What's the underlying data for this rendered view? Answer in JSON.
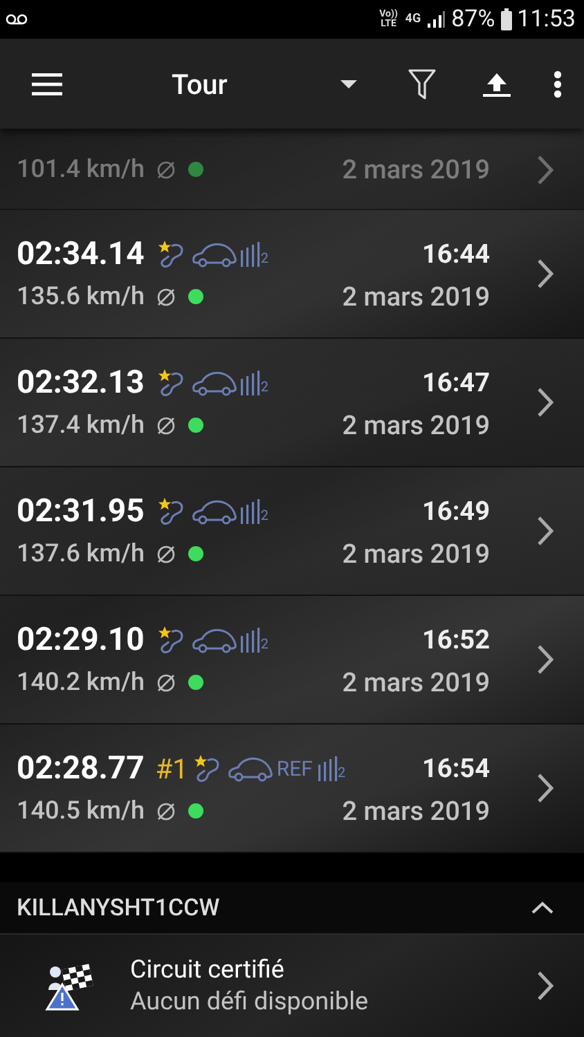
{
  "status_bar": {
    "volte": "Vo))",
    "lte": "LTE",
    "battery": "87%",
    "time": "11:53",
    "network": "4G"
  },
  "toolbar": {
    "title": "Tour"
  },
  "laps": [
    {
      "kind": "partial",
      "speed": "101.4 km/h",
      "date": "2 mars 2019"
    },
    {
      "kind": "full",
      "time": "02:34.14",
      "clock": "16:44",
      "speed": "135.6 km/h",
      "date": "2 mars 2019",
      "sensors": "2"
    },
    {
      "kind": "full",
      "time": "02:32.13",
      "clock": "16:47",
      "speed": "137.4 km/h",
      "date": "2 mars 2019",
      "sensors": "2"
    },
    {
      "kind": "full",
      "time": "02:31.95",
      "clock": "16:49",
      "speed": "137.6 km/h",
      "date": "2 mars 2019",
      "sensors": "2"
    },
    {
      "kind": "full",
      "time": "02:29.10",
      "clock": "16:52",
      "speed": "140.2 km/h",
      "date": "2 mars 2019",
      "sensors": "2"
    },
    {
      "kind": "full",
      "time": "02:28.77",
      "rank": "#1",
      "ref": "REF",
      "clock": "16:54",
      "speed": "140.5 km/h",
      "date": "2 mars 2019",
      "sensors": "2"
    }
  ],
  "section": {
    "title": "KILLANYSHT1CCW",
    "expanded": true
  },
  "challenge": {
    "title": "Circuit certifié",
    "subtitle": "Aucun défi disponible"
  }
}
